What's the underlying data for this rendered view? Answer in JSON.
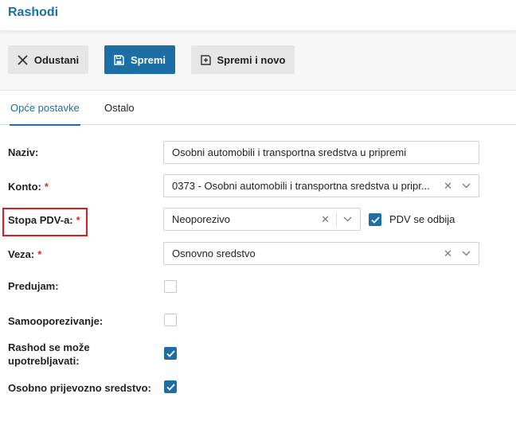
{
  "header": {
    "title": "Rashodi"
  },
  "toolbar": {
    "cancel_label": "Odustani",
    "save_label": "Spremi",
    "save_new_label": "Spremi i novo"
  },
  "tabs": [
    {
      "label": "Opće postavke",
      "active": true
    },
    {
      "label": "Ostalo",
      "active": false
    }
  ],
  "form": {
    "naziv": {
      "label": "Naziv:",
      "value": "Osobni automobili i transportna sredstva u pripremi"
    },
    "konto": {
      "label": "Konto:",
      "required_mark": "*",
      "value": "0373 - Osobni automobili i transportna sredstva u pripr..."
    },
    "stopa_pdv": {
      "label": "Stopa PDV-a:",
      "required_mark": "*",
      "value": "Neoporezivo",
      "pdv_se_odbija_label": "PDV se odbija",
      "pdv_se_odbija_checked": true
    },
    "veza": {
      "label": "Veza:",
      "required_mark": "*",
      "value": "Osnovno sredstvo"
    },
    "predujam": {
      "label": "Predujam:",
      "checked": false
    },
    "samooporezivanje": {
      "label": "Samooporezivanje:",
      "checked": false
    },
    "rashod": {
      "label_line1": "Rashod se može",
      "label_line2": "upotrebljavati:",
      "checked": true
    },
    "osobno": {
      "label": "Osobno prijevozno sredstvo:",
      "checked": true
    }
  },
  "colors": {
    "accent": "#1c6ea4",
    "title": "#1d6ea9",
    "required": "#d32f2f",
    "highlight_border": "#e01b1b"
  },
  "icons": {
    "cancel": "close-icon",
    "save": "floppy-disk-icon",
    "save_new": "floppy-disk-plus-icon",
    "clear": "clear-x-icon",
    "dropdown": "chevron-down-icon",
    "check": "checkmark-icon"
  }
}
